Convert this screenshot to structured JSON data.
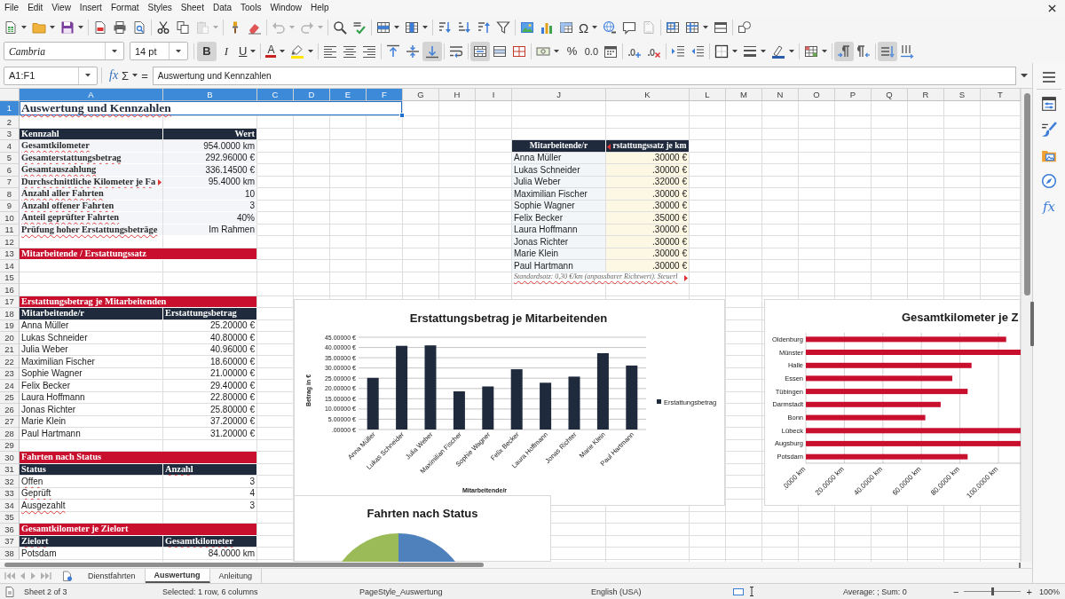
{
  "menu_bar": {
    "items": [
      "File",
      "Edit",
      "View",
      "Insert",
      "Format",
      "Styles",
      "Sheet",
      "Data",
      "Tools",
      "Window",
      "Help"
    ]
  },
  "standard_toolbar": [
    [
      {
        "kind": "new",
        "dropdown": true,
        "disabled": false
      },
      {
        "kind": "open",
        "dropdown": true,
        "disabled": false
      },
      {
        "kind": "save",
        "dropdown": true,
        "disabled": false
      }
    ],
    [
      {
        "kind": "export-pdf",
        "dropdown": false,
        "disabled": false
      },
      {
        "kind": "print",
        "dropdown": false,
        "disabled": false
      },
      {
        "kind": "print-preview",
        "dropdown": false,
        "disabled": false
      }
    ],
    [
      {
        "kind": "cut",
        "dropdown": false,
        "disabled": false
      },
      {
        "kind": "copy",
        "dropdown": false,
        "disabled": false
      },
      {
        "kind": "paste",
        "dropdown": true,
        "disabled": true
      }
    ],
    [
      {
        "kind": "clone-formatting",
        "dropdown": false,
        "disabled": false
      },
      {
        "kind": "clear-formatting",
        "dropdown": false,
        "disabled": false
      }
    ],
    [
      {
        "kind": "undo",
        "dropdown": true,
        "disabled": true
      },
      {
        "kind": "redo",
        "dropdown": true,
        "disabled": true
      }
    ],
    [
      {
        "kind": "find-replace",
        "dropdown": false,
        "disabled": false
      },
      {
        "kind": "spelling",
        "dropdown": false,
        "disabled": false
      }
    ],
    [
      {
        "kind": "rows",
        "dropdown": true,
        "disabled": false
      },
      {
        "kind": "columns",
        "dropdown": true,
        "disabled": false
      }
    ],
    [
      {
        "kind": "sort",
        "dropdown": false,
        "disabled": false
      },
      {
        "kind": "sort-ascending",
        "dropdown": false,
        "disabled": false
      },
      {
        "kind": "sort-descending",
        "dropdown": false,
        "disabled": false
      },
      {
        "kind": "autofilter",
        "dropdown": false,
        "disabled": false
      }
    ],
    [
      {
        "kind": "image",
        "dropdown": false,
        "disabled": false
      },
      {
        "kind": "chart",
        "dropdown": false,
        "disabled": false
      },
      {
        "kind": "pivot-table",
        "dropdown": false,
        "disabled": false
      },
      {
        "kind": "special-character",
        "label": "Ω",
        "dropdown": true,
        "disabled": false
      },
      {
        "kind": "hyperlink",
        "dropdown": false,
        "disabled": false
      },
      {
        "kind": "comment",
        "dropdown": false,
        "disabled": false
      },
      {
        "kind": "header-footer",
        "dropdown": false,
        "disabled": true
      }
    ],
    [
      {
        "kind": "print-area",
        "dropdown": false,
        "disabled": false
      },
      {
        "kind": "freeze",
        "dropdown": true,
        "disabled": false
      },
      {
        "kind": "split-window",
        "dropdown": false,
        "disabled": false
      }
    ],
    [
      {
        "kind": "shapes",
        "dropdown": false,
        "disabled": false
      }
    ]
  ],
  "formatting_toolbar": {
    "font_name": "Cambria",
    "font_size": "14 pt",
    "groups": [
      [
        {
          "kind": "bold",
          "label": "B",
          "dropdown": false,
          "pressed": true
        },
        {
          "kind": "italic",
          "label": "I",
          "dropdown": false,
          "pressed": false
        },
        {
          "kind": "underline",
          "label": "U",
          "dropdown": true,
          "pressed": false
        }
      ],
      [
        {
          "kind": "font-color",
          "label": "A",
          "dropdown": true,
          "pressed": false
        },
        {
          "kind": "highlight",
          "dropdown": true,
          "pressed": false
        }
      ],
      [
        {
          "kind": "align-left",
          "dropdown": false,
          "pressed": false
        },
        {
          "kind": "align-center",
          "dropdown": false,
          "pressed": false
        },
        {
          "kind": "align-right",
          "dropdown": false,
          "pressed": false
        }
      ],
      [
        {
          "kind": "align-top",
          "dropdown": false,
          "pressed": false
        },
        {
          "kind": "align-middle",
          "dropdown": false,
          "pressed": false
        },
        {
          "kind": "align-bottom",
          "dropdown": false,
          "pressed": true
        }
      ],
      [
        {
          "kind": "wrap-text",
          "dropdown": false,
          "pressed": false
        }
      ],
      [
        {
          "kind": "merge-center",
          "dropdown": false,
          "pressed": true
        },
        {
          "kind": "merge",
          "dropdown": false,
          "pressed": false
        },
        {
          "kind": "unmerge",
          "dropdown": false,
          "pressed": false
        }
      ],
      [
        {
          "kind": "currency",
          "dropdown": true,
          "pressed": false
        },
        {
          "kind": "percent",
          "label": "%",
          "dropdown": false,
          "pressed": false
        },
        {
          "kind": "number-format",
          "label": "0.0",
          "dropdown": false,
          "pressed": false
        },
        {
          "kind": "date",
          "dropdown": false,
          "pressed": false
        }
      ],
      [
        {
          "kind": "add-decimal",
          "dropdown": false,
          "pressed": false
        },
        {
          "kind": "delete-decimal",
          "dropdown": false,
          "pressed": false
        }
      ],
      [
        {
          "kind": "indent-increase",
          "dropdown": false,
          "pressed": false
        },
        {
          "kind": "indent-decrease",
          "dropdown": false,
          "pressed": false
        }
      ],
      [
        {
          "kind": "borders",
          "dropdown": true,
          "pressed": false
        },
        {
          "kind": "border-style",
          "dropdown": true,
          "pressed": false
        },
        {
          "kind": "border-color",
          "dropdown": true,
          "pressed": false
        }
      ],
      [
        {
          "kind": "conditional",
          "dropdown": true,
          "pressed": false
        }
      ],
      [
        {
          "kind": "ltr",
          "dropdown": false,
          "pressed": true
        },
        {
          "kind": "rtl",
          "dropdown": false,
          "pressed": false
        }
      ],
      [
        {
          "kind": "text-horizontal",
          "dropdown": false,
          "pressed": true
        },
        {
          "kind": "text-vertical",
          "dropdown": false,
          "pressed": false
        }
      ]
    ]
  },
  "formula_bar": {
    "name_box": "A1:F1",
    "function_wizard": "fx",
    "sum": "Σ",
    "equals": "=",
    "content": "Auswertung und Kennzahlen"
  },
  "sidebar": {
    "decks": [
      {
        "kind": "properties"
      },
      {
        "kind": "styles"
      },
      {
        "kind": "gallery"
      },
      {
        "kind": "navigator"
      },
      {
        "kind": "functions",
        "label": "fx"
      }
    ]
  },
  "sheet": {
    "columns": [
      {
        "label": "A",
        "selected": true
      },
      {
        "label": "B",
        "selected": true
      },
      {
        "label": "C",
        "selected": true
      },
      {
        "label": "D",
        "selected": true
      },
      {
        "label": "E",
        "selected": true
      },
      {
        "label": "F",
        "selected": true
      },
      {
        "label": "G",
        "selected": false
      },
      {
        "label": "H",
        "selected": false
      },
      {
        "label": "I",
        "selected": false
      },
      {
        "label": "J",
        "selected": false
      },
      {
        "label": "K",
        "selected": false
      },
      {
        "label": "L",
        "selected": false
      },
      {
        "label": "M",
        "selected": false
      },
      {
        "label": "N",
        "selected": false
      },
      {
        "label": "O",
        "selected": false
      },
      {
        "label": "P",
        "selected": false
      },
      {
        "label": "Q",
        "selected": false
      },
      {
        "label": "R",
        "selected": false
      },
      {
        "label": "S",
        "selected": false
      },
      {
        "label": "T",
        "selected": false
      }
    ],
    "rows": [
      {
        "label": "1",
        "selected": true,
        "cells": {
          "A": {
            "kind": "title",
            "text": "Auswertung und Kennzahlen",
            "spell_marked": true,
            "clipped": false
          }
        }
      },
      {
        "label": "2",
        "selected": false
      },
      {
        "label": "3",
        "selected": false,
        "cells": {
          "A": {
            "kind": "header",
            "text": "Kennzahl",
            "spell_marked": false,
            "clipped": false
          },
          "B": {
            "kind": "header-right",
            "text": "Wert",
            "spell_marked": false,
            "clipped": false
          }
        }
      },
      {
        "label": "4",
        "selected": false,
        "cells": {
          "A": {
            "kind": "label",
            "text": "Gesamtkilometer",
            "spell_marked": true,
            "clipped": false
          },
          "B": {
            "kind": "value",
            "text": "954.0000 km",
            "spell_marked": false,
            "clipped": false
          },
          "J": {
            "kind": "header-center",
            "text": "Mitarbeitende/r",
            "spell_marked": false,
            "clipped": false
          },
          "K": {
            "kind": "header-center",
            "text": "rstattungssatz je km",
            "spell_marked": false,
            "clipped": true
          }
        }
      },
      {
        "label": "5",
        "selected": false,
        "cells": {
          "A": {
            "kind": "label",
            "text": "Gesamterstattungsbetrag",
            "spell_marked": true,
            "clipped": false
          },
          "B": {
            "kind": "value",
            "text": "292.96000 €",
            "spell_marked": false,
            "clipped": false
          },
          "J": {
            "kind": "name-band",
            "text": "Anna Müller",
            "spell_marked": false,
            "clipped": false
          },
          "K": {
            "kind": "rate",
            "text": ".30000 €",
            "spell_marked": false,
            "clipped": false
          }
        }
      },
      {
        "label": "6",
        "selected": false,
        "cells": {
          "A": {
            "kind": "label",
            "text": "Gesamtauszahlung",
            "spell_marked": true,
            "clipped": false
          },
          "B": {
            "kind": "value",
            "text": "336.14500 €",
            "spell_marked": false,
            "clipped": false
          },
          "J": {
            "kind": "name-band",
            "text": "Lukas Schneider",
            "spell_marked": false,
            "clipped": false
          },
          "K": {
            "kind": "rate",
            "text": ".30000 €",
            "spell_marked": false,
            "clipped": false
          }
        }
      },
      {
        "label": "7",
        "selected": false,
        "cells": {
          "A": {
            "kind": "label",
            "text": "Durchschnittliche Kilometer je Fa",
            "spell_marked": true,
            "clipped": true
          },
          "B": {
            "kind": "value",
            "text": "95.4000 km",
            "spell_marked": false,
            "clipped": false
          },
          "J": {
            "kind": "name-band",
            "text": "Julia Weber",
            "spell_marked": false,
            "clipped": false
          },
          "K": {
            "kind": "rate",
            "text": ".32000 €",
            "spell_marked": false,
            "clipped": false
          }
        }
      },
      {
        "label": "8",
        "selected": false,
        "cells": {
          "A": {
            "kind": "label",
            "text": "Anzahl aller Fahrten",
            "spell_marked": true,
            "clipped": false
          },
          "B": {
            "kind": "value",
            "text": "10",
            "spell_marked": false,
            "clipped": false
          },
          "J": {
            "kind": "name-band",
            "text": "Maximilian Fischer",
            "spell_marked": false,
            "clipped": false
          },
          "K": {
            "kind": "rate",
            "text": ".30000 €",
            "spell_marked": false,
            "clipped": false
          }
        }
      },
      {
        "label": "9",
        "selected": false,
        "cells": {
          "A": {
            "kind": "label",
            "text": "Anzahl offener Fahrten",
            "spell_marked": true,
            "clipped": false
          },
          "B": {
            "kind": "value",
            "text": "3",
            "spell_marked": false,
            "clipped": false
          },
          "J": {
            "kind": "name-band",
            "text": "Sophie Wagner",
            "spell_marked": false,
            "clipped": false
          },
          "K": {
            "kind": "rate",
            "text": ".30000 €",
            "spell_marked": false,
            "clipped": false
          }
        }
      },
      {
        "label": "10",
        "selected": false,
        "cells": {
          "A": {
            "kind": "label",
            "text": "Anteil geprüfter Fahrten",
            "spell_marked": true,
            "clipped": false
          },
          "B": {
            "kind": "value",
            "text": "40%",
            "spell_marked": false,
            "clipped": false
          },
          "J": {
            "kind": "name-band",
            "text": "Felix Becker",
            "spell_marked": false,
            "clipped": false
          },
          "K": {
            "kind": "rate",
            "text": ".35000 €",
            "spell_marked": false,
            "clipped": false
          }
        }
      },
      {
        "label": "11",
        "selected": false,
        "cells": {
          "A": {
            "kind": "label",
            "text": "Prüfung hoher Erstattungsbeträge",
            "spell_marked": true,
            "clipped": false
          },
          "B": {
            "kind": "value",
            "text": "Im Rahmen",
            "spell_marked": false,
            "clipped": false
          },
          "J": {
            "kind": "name-band",
            "text": "Laura Hoffmann",
            "spell_marked": false,
            "clipped": false
          },
          "K": {
            "kind": "rate",
            "text": ".30000 €",
            "spell_marked": false,
            "clipped": false
          }
        }
      },
      {
        "label": "12",
        "selected": false,
        "cells": {
          "J": {
            "kind": "name-band",
            "text": "Jonas Richter",
            "spell_marked": false,
            "clipped": false
          },
          "K": {
            "kind": "rate",
            "text": ".30000 €",
            "spell_marked": false,
            "clipped": false
          }
        }
      },
      {
        "label": "13",
        "selected": false,
        "cells": {
          "A": {
            "kind": "section",
            "text": "Mitarbeitende / Erstattungssatz",
            "spell_marked": false,
            "clipped": false
          },
          "J": {
            "kind": "name-band",
            "text": "Marie Klein",
            "spell_marked": false,
            "clipped": false
          },
          "K": {
            "kind": "rate",
            "text": ".30000 €",
            "spell_marked": false,
            "clipped": false
          }
        }
      },
      {
        "label": "14",
        "selected": false,
        "cells": {
          "J": {
            "kind": "name-band",
            "text": "Paul Hartmann",
            "spell_marked": false,
            "clipped": false
          },
          "K": {
            "kind": "rate",
            "text": ".30000 €",
            "spell_marked": false,
            "clipped": false
          }
        }
      },
      {
        "label": "15",
        "selected": false,
        "cells": {
          "J": {
            "kind": "note",
            "text": "Standardsatz: 0,30 €/km (anpassbarer Richtwert). Steuerl",
            "spell_marked": true,
            "clipped": true
          }
        }
      },
      {
        "label": "16",
        "selected": false
      },
      {
        "label": "17",
        "selected": false,
        "cells": {
          "A": {
            "kind": "section",
            "text": "Erstattungsbetrag je Mitarbeitenden",
            "spell_marked": false,
            "clipped": false
          }
        }
      },
      {
        "label": "18",
        "selected": false,
        "cells": {
          "A": {
            "kind": "header",
            "text": "Mitarbeitende/r",
            "spell_marked": false,
            "clipped": false
          },
          "B": {
            "kind": "header",
            "text": "Erstattungsbetrag",
            "spell_marked": false,
            "clipped": false
          }
        }
      },
      {
        "label": "19",
        "selected": false,
        "cells": {
          "A": {
            "kind": "name",
            "text": "Anna Müller",
            "spell_marked": false,
            "clipped": false
          },
          "B": {
            "kind": "amount",
            "text": "25.20000 €",
            "spell_marked": false,
            "clipped": false
          }
        }
      },
      {
        "label": "20",
        "selected": false,
        "cells": {
          "A": {
            "kind": "name",
            "text": "Lukas Schneider",
            "spell_marked": false,
            "clipped": false
          },
          "B": {
            "kind": "amount",
            "text": "40.80000 €",
            "spell_marked": false,
            "clipped": false
          }
        }
      },
      {
        "label": "21",
        "selected": false,
        "cells": {
          "A": {
            "kind": "name",
            "text": "Julia Weber",
            "spell_marked": false,
            "clipped": false
          },
          "B": {
            "kind": "amount",
            "text": "40.96000 €",
            "spell_marked": false,
            "clipped": false
          }
        }
      },
      {
        "label": "22",
        "selected": false,
        "cells": {
          "A": {
            "kind": "name",
            "text": "Maximilian Fischer",
            "spell_marked": false,
            "clipped": false
          },
          "B": {
            "kind": "amount",
            "text": "18.60000 €",
            "spell_marked": false,
            "clipped": false
          }
        }
      },
      {
        "label": "23",
        "selected": false,
        "cells": {
          "A": {
            "kind": "name",
            "text": "Sophie Wagner",
            "spell_marked": false,
            "clipped": false
          },
          "B": {
            "kind": "amount",
            "text": "21.00000 €",
            "spell_marked": false,
            "clipped": false
          }
        }
      },
      {
        "label": "24",
        "selected": false,
        "cells": {
          "A": {
            "kind": "name",
            "text": "Felix Becker",
            "spell_marked": false,
            "clipped": false
          },
          "B": {
            "kind": "amount",
            "text": "29.40000 €",
            "spell_marked": false,
            "clipped": false
          }
        }
      },
      {
        "label": "25",
        "selected": false,
        "cells": {
          "A": {
            "kind": "name",
            "text": "Laura Hoffmann",
            "spell_marked": false,
            "clipped": false
          },
          "B": {
            "kind": "amount",
            "text": "22.80000 €",
            "spell_marked": false,
            "clipped": false
          }
        }
      },
      {
        "label": "26",
        "selected": false,
        "cells": {
          "A": {
            "kind": "name",
            "text": "Jonas Richter",
            "spell_marked": false,
            "clipped": false
          },
          "B": {
            "kind": "amount",
            "text": "25.80000 €",
            "spell_marked": false,
            "clipped": false
          }
        }
      },
      {
        "label": "27",
        "selected": false,
        "cells": {
          "A": {
            "kind": "name",
            "text": "Marie Klein",
            "spell_marked": false,
            "clipped": false
          },
          "B": {
            "kind": "amount",
            "text": "37.20000 €",
            "spell_marked": false,
            "clipped": false
          }
        }
      },
      {
        "label": "28",
        "selected": false,
        "cells": {
          "A": {
            "kind": "name",
            "text": "Paul Hartmann",
            "spell_marked": false,
            "clipped": false
          },
          "B": {
            "kind": "amount",
            "text": "31.20000 €",
            "spell_marked": false,
            "clipped": false
          }
        }
      },
      {
        "label": "29",
        "selected": false
      },
      {
        "label": "30",
        "selected": false,
        "cells": {
          "A": {
            "kind": "section",
            "text": "Fahrten nach Status",
            "spell_marked": false,
            "clipped": false
          }
        }
      },
      {
        "label": "31",
        "selected": false,
        "cells": {
          "A": {
            "kind": "header",
            "text": "Status",
            "spell_marked": false,
            "clipped": false
          },
          "B": {
            "kind": "header",
            "text": "Anzahl",
            "spell_marked": true,
            "clipped": false
          }
        }
      },
      {
        "label": "32",
        "selected": false,
        "cells": {
          "A": {
            "kind": "name",
            "text": "Offen",
            "spell_marked": true,
            "clipped": false
          },
          "B": {
            "kind": "amount",
            "text": "3",
            "spell_marked": false,
            "clipped": false
          }
        }
      },
      {
        "label": "33",
        "selected": false,
        "cells": {
          "A": {
            "kind": "name",
            "text": "Geprüft",
            "spell_marked": true,
            "clipped": false
          },
          "B": {
            "kind": "amount",
            "text": "4",
            "spell_marked": false,
            "clipped": false
          }
        }
      },
      {
        "label": "34",
        "selected": false,
        "cells": {
          "A": {
            "kind": "name",
            "text": "Ausgezahlt",
            "spell_marked": true,
            "clipped": false
          },
          "B": {
            "kind": "amount",
            "text": "3",
            "spell_marked": false,
            "clipped": false
          }
        }
      },
      {
        "label": "35",
        "selected": false
      },
      {
        "label": "36",
        "selected": false,
        "cells": {
          "A": {
            "kind": "section",
            "text": "Gesamtkilometer je Zielort",
            "spell_marked": false,
            "clipped": false
          }
        }
      },
      {
        "label": "37",
        "selected": false,
        "cells": {
          "A": {
            "kind": "header",
            "text": "Zielort",
            "spell_marked": true,
            "clipped": false
          },
          "B": {
            "kind": "header",
            "text": "Gesamtkilometer",
            "spell_marked": true,
            "clipped": false
          }
        }
      },
      {
        "label": "38",
        "selected": false,
        "cells": {
          "A": {
            "kind": "name",
            "text": "Potsdam",
            "spell_marked": false,
            "clipped": false
          },
          "B": {
            "kind": "amount",
            "text": "84.0000 km",
            "spell_marked": false,
            "clipped": false
          }
        }
      }
    ]
  },
  "charts": [
    {
      "chart_data": {
        "type": "bar",
        "orientation": "vertical",
        "title": "Erstattungsbetrag je Mitarbeitenden",
        "xlabel": "Mitarbeitende/r",
        "ylabel": "Betrag in €",
        "categories": [
          "Anna Müller",
          "Lukas Schneider",
          "Julia Weber",
          "Maximilian Fischer",
          "Sophie Wagner",
          "Felix Becker",
          "Laura Hoffmann",
          "Jonas Richter",
          "Marie Klein",
          "Paul Hartmann"
        ],
        "series": [
          {
            "name": "Erstattungsbetrag",
            "color": "#1f2a3c",
            "values": [
              25.2,
              40.8,
              41,
              18.6,
              21,
              29.4,
              22.8,
              25.8,
              37.2,
              31.2
            ]
          }
        ],
        "ylim": [
          0,
          45
        ],
        "yticks": [
          {
            "value": 0,
            "label": ".00000 €"
          },
          {
            "value": 5,
            "label": "5.00000 €"
          },
          {
            "value": 10,
            "label": "10.00000 €"
          },
          {
            "value": 15,
            "label": "15.00000 €"
          },
          {
            "value": 20,
            "label": "20.00000 €"
          },
          {
            "value": 25,
            "label": "25.00000 €"
          },
          {
            "value": 30,
            "label": "30.00000 €"
          },
          {
            "value": 35,
            "label": "35.00000 €"
          },
          {
            "value": 40,
            "label": "40.00000 €"
          },
          {
            "value": 45,
            "label": "45.00000 €"
          }
        ],
        "grid": true
      }
    },
    {
      "chart_data": {
        "type": "bar",
        "orientation": "horizontal",
        "title": "Gesamtkilometer je Z",
        "categories": [
          "Oldenburg",
          "Münster",
          "Halle",
          "Essen",
          "Tübingen",
          "Darmstadt",
          "Bonn",
          "Lübeck",
          "Augsburg",
          "Potsdam"
        ],
        "series": [
          {
            "color": "#c8102e",
            "values": [
              104,
              111.5,
              86,
              76,
              84,
              70,
              62,
              111.5,
              111.5,
              84
            ]
          }
        ],
        "xlim": [
          0,
          111.5
        ],
        "xticks": [
          {
            "value": 0,
            "label": ".0000 km"
          },
          {
            "value": 20,
            "label": "20.0000 km"
          },
          {
            "value": 40,
            "label": "40.0000 km"
          },
          {
            "value": 60,
            "label": "60.0000 km"
          },
          {
            "value": 80,
            "label": "80.0000 km"
          },
          {
            "value": 100,
            "label": "100.0000 km"
          }
        ],
        "grid": true
      }
    },
    {
      "kind": "pie-chart",
      "title": "Fahrten nach Status",
      "slices": [
        {
          "color": "#4f81bd"
        },
        {
          "color": "#9bbb59"
        }
      ]
    }
  ],
  "sheet_tabs": [
    {
      "label": "Dienstfahrten",
      "selected": false
    },
    {
      "label": "Auswertung",
      "selected": true
    },
    {
      "label": "Anleitung",
      "selected": false
    }
  ],
  "status_bar": {
    "sheet_info": "Sheet 2 of 3",
    "selection": "Selected: 1 row, 6 columns",
    "page_style": "PageStyle_Auswertung",
    "language": "English (USA)",
    "statistics": "Average: ; Sum: 0",
    "zoom": {
      "out": "−",
      "in": "+",
      "level": 0.5,
      "reading": "100%"
    }
  }
}
